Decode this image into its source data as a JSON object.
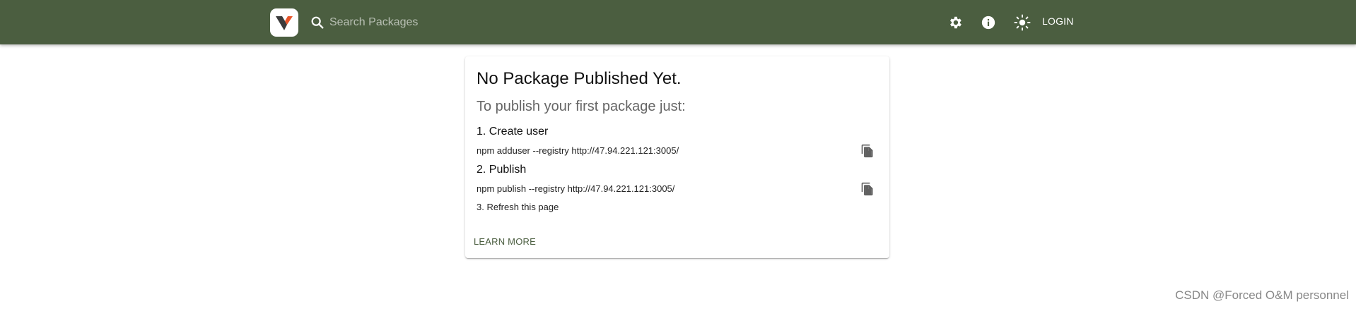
{
  "header": {
    "logo_icon": "verdaccio-logo-icon",
    "search": {
      "placeholder": "Search Packages",
      "value": ""
    },
    "icons": [
      "settings-gear-icon",
      "info-icon",
      "theme-brightness-icon"
    ],
    "login_label": "LOGIN",
    "colors": {
      "appbar": "#4b5e40",
      "text": "#ffffff"
    }
  },
  "card": {
    "title": "No Package Published Yet.",
    "subtitle": "To publish your first package just:",
    "steps": [
      {
        "title": "1. Create user",
        "command": "npm adduser --registry http://47.94.221.121:3005/"
      },
      {
        "title": "2. Publish",
        "command": "npm publish --registry http://47.94.221.121:3005/"
      }
    ],
    "step3": "3. Refresh this page",
    "learn_more": "LEARN MORE",
    "copy_icon": "copy-icon"
  },
  "watermark": "CSDN @Forced O&M personnel"
}
